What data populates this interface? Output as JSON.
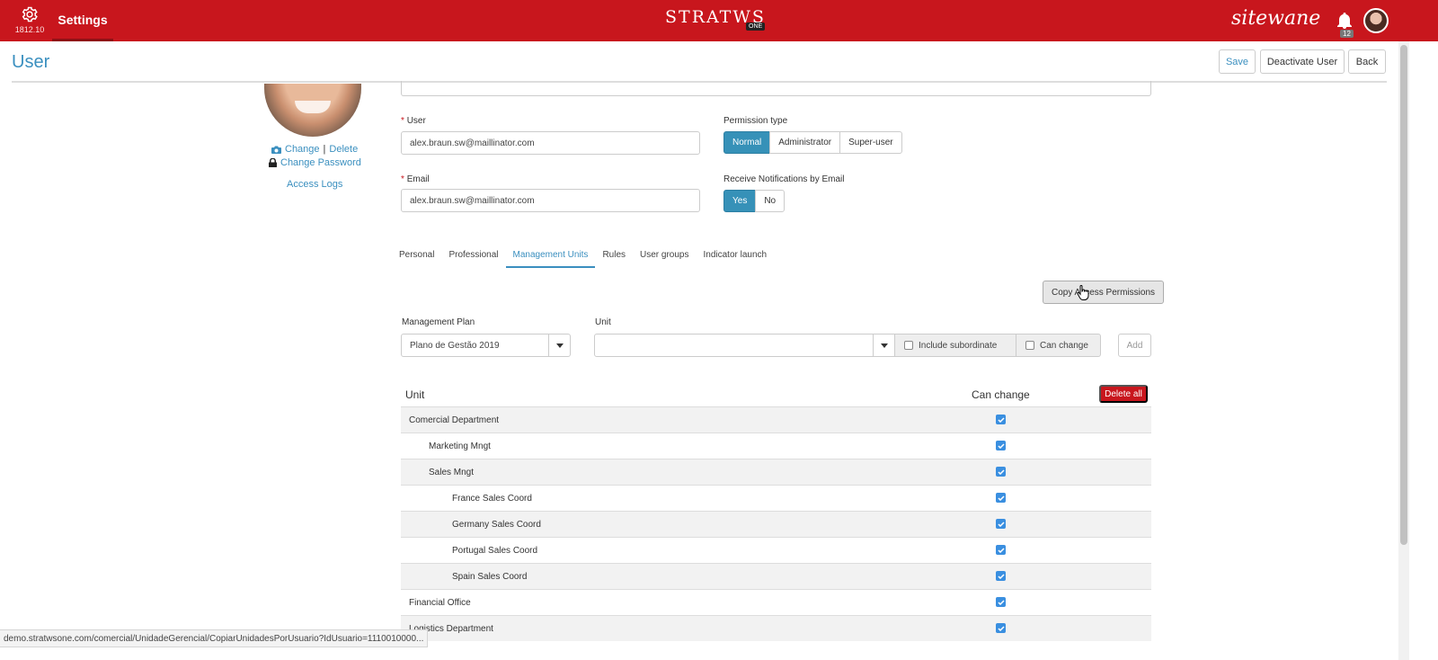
{
  "topbar": {
    "version": "1812.10",
    "settings_label": "Settings",
    "logo_text": "STRATWS",
    "logo_badge": "ONE",
    "brand_text": "sitewane",
    "notification_count": "12",
    "color": "#c8161d"
  },
  "page": {
    "title": "User",
    "save_label": "Save",
    "deactivate_label": "Deactivate User",
    "back_label": "Back"
  },
  "profile": {
    "change_label": "Change",
    "separator": "|",
    "delete_label": "Delete",
    "change_password_label": "Change Password",
    "access_logs_label": "Access Logs"
  },
  "form": {
    "user_label": "User",
    "user_value": "alex.braun.sw@maillinator.com",
    "email_label": "Email",
    "email_value": "alex.braun.sw@maillinator.com",
    "required_mark": "*",
    "permission_label": "Permission type",
    "permission_options": [
      "Normal",
      "Administrator",
      "Super-user"
    ],
    "permission_selected": "Normal",
    "notify_label": "Receive Notifications by Email",
    "notify_options": [
      "Yes",
      "No"
    ],
    "notify_selected": "Yes"
  },
  "tabs": [
    "Personal",
    "Professional",
    "Management Units",
    "Rules",
    "User groups",
    "Indicator launch"
  ],
  "active_tab": "Management Units",
  "units": {
    "copy_label": "Copy Access Permissions",
    "plan_label": "Management Plan",
    "plan_value": "Plano de Gestão 2019",
    "unit_label": "Unit",
    "unit_value": "",
    "include_subordinate_label": "Include subordinate",
    "can_change_label": "Can change",
    "add_label": "Add",
    "col_unit": "Unit",
    "col_can_change": "Can change",
    "delete_all_label": "Delete all",
    "rows": [
      {
        "name": "Comercial Department",
        "level": 0,
        "can_change": true
      },
      {
        "name": "Marketing Mngt",
        "level": 1,
        "can_change": true
      },
      {
        "name": "Sales Mngt",
        "level": 1,
        "can_change": true
      },
      {
        "name": "France Sales Coord",
        "level": 2,
        "can_change": true
      },
      {
        "name": "Germany Sales Coord",
        "level": 2,
        "can_change": true
      },
      {
        "name": "Portugal Sales Coord",
        "level": 2,
        "can_change": true
      },
      {
        "name": "Spain Sales Coord",
        "level": 2,
        "can_change": true
      },
      {
        "name": "Financial Office",
        "level": 0,
        "can_change": true
      },
      {
        "name": "Logistics Department",
        "level": 0,
        "can_change": true
      }
    ]
  },
  "statusbar": {
    "url": "demo.stratwsone.com/comercial/UnidadeGerencial/CopiarUnidadesPorUsuario?IdUsuario=1110010000..."
  }
}
